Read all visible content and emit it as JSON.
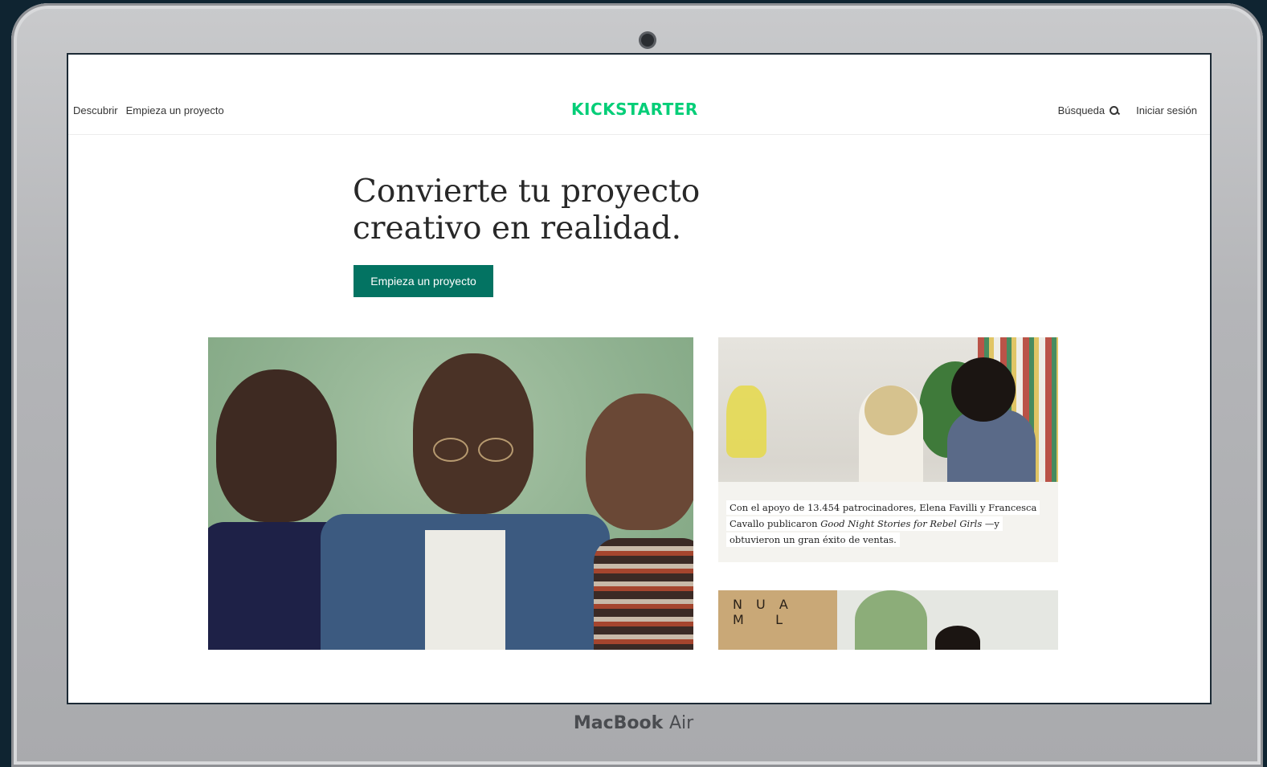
{
  "device": {
    "brand_bold": "MacBook",
    "brand_light": "Air"
  },
  "nav": {
    "discover": "Descubrir",
    "start_project": "Empieza un proyecto",
    "logo": "KICKSTARTER",
    "search": "Búsqueda",
    "login": "Iniciar sesión"
  },
  "hero": {
    "title_line1": "Convierte tu proyecto",
    "title_line2": "creativo en realidad.",
    "cta": "Empieza un proyecto"
  },
  "story": {
    "caption_pre": "Con el apoyo de 13.454 patrocinadores, Elena Favilli y Francesca Cavallo publicaron ",
    "caption_title": "Good Night Stories for Rebel Girls",
    "caption_post": " —y obtuvieron un gran éxito de ventas."
  },
  "colors": {
    "brand_green": "#05ce78",
    "cta_green": "#037362"
  }
}
